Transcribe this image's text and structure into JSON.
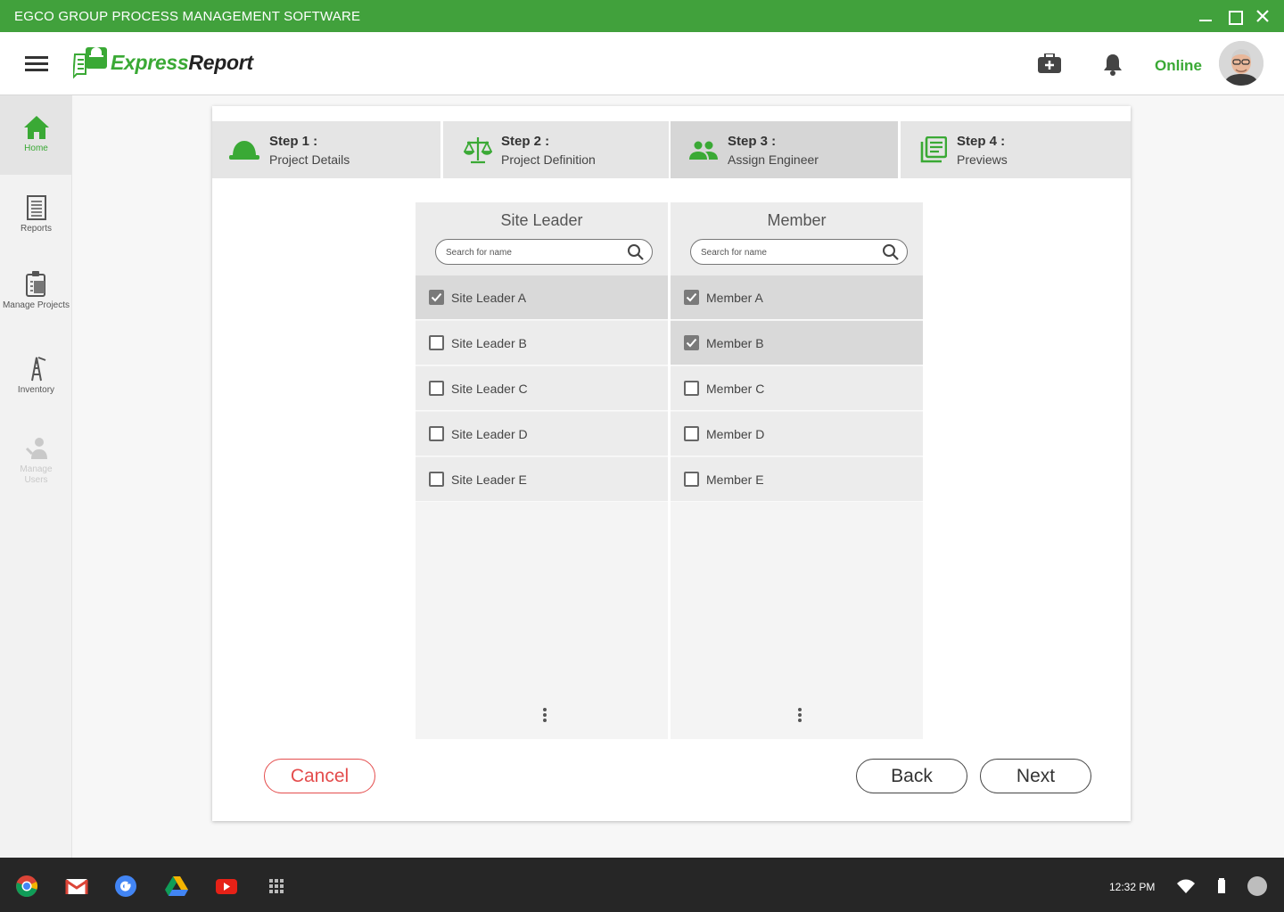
{
  "window": {
    "title": "EGCO GROUP PROCESS MANAGEMENT SOFTWARE"
  },
  "header": {
    "logo_part1": "Express",
    "logo_part2": "Report",
    "status": "Online"
  },
  "sidebar": {
    "items": [
      {
        "label": "Home",
        "icon": "home-icon",
        "state": "active"
      },
      {
        "label": "Reports",
        "icon": "reports-icon"
      },
      {
        "label": "Manage Projects",
        "icon": "manage-projects-icon"
      },
      {
        "label": "Inventory",
        "icon": "inventory-icon"
      },
      {
        "label": "Manage Users",
        "icon": "manage-users-icon",
        "state": "disabled"
      }
    ]
  },
  "steps": [
    {
      "title": "Step 1 :",
      "subtitle": "Project Details",
      "icon": "hard-hat-icon"
    },
    {
      "title": "Step 2 :",
      "subtitle": "Project Definition",
      "icon": "scale-icon"
    },
    {
      "title": "Step 3 :",
      "subtitle": "Assign Engineer",
      "icon": "people-icon",
      "state": "active"
    },
    {
      "title": "Step 4 :",
      "subtitle": "Previews",
      "icon": "document-list-icon"
    }
  ],
  "site_leader": {
    "title": "Site Leader",
    "search_placeholder": "Search for name",
    "items": [
      {
        "label": "Site Leader A",
        "checked": true
      },
      {
        "label": "Site Leader B",
        "checked": false
      },
      {
        "label": "Site Leader C",
        "checked": false
      },
      {
        "label": "Site Leader D",
        "checked": false
      },
      {
        "label": "Site Leader E",
        "checked": false
      }
    ]
  },
  "member": {
    "title": "Member",
    "search_placeholder": "Search for name",
    "items": [
      {
        "label": "Member A",
        "checked": true
      },
      {
        "label": "Member B",
        "checked": true
      },
      {
        "label": "Member C",
        "checked": false
      },
      {
        "label": "Member D",
        "checked": false
      },
      {
        "label": "Member E",
        "checked": false
      }
    ]
  },
  "buttons": {
    "cancel": "Cancel",
    "back": "Back",
    "next": "Next"
  },
  "taskbar": {
    "apps": [
      "chrome-icon",
      "gmail-icon",
      "google-icon",
      "drive-icon",
      "youtube-icon",
      "app-launcher-icon"
    ],
    "time": "12:32 PM"
  },
  "colors": {
    "brand_green": "#41a13c",
    "accent_green": "#3aa935",
    "cancel_red": "#e44d4d"
  }
}
